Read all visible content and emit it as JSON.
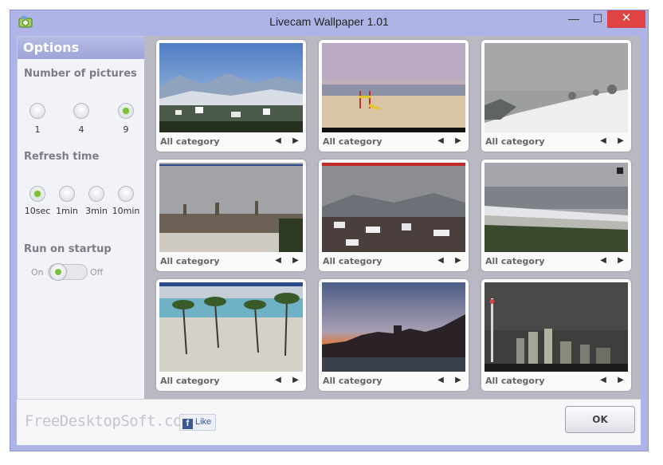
{
  "window": {
    "title": "Livecam Wallpaper 1.01",
    "min_glyph": "—",
    "max_glyph": "☐",
    "close_glyph": "✕",
    "app_icon": "camera-icon"
  },
  "sidebar": {
    "header": "Options",
    "number_of_pictures": {
      "title": "Number of pictures",
      "options": [
        "1",
        "4",
        "9"
      ],
      "selected": "9"
    },
    "refresh_time": {
      "title": "Refresh time",
      "options": [
        "10sec",
        "1min",
        "3min",
        "10min"
      ],
      "selected": "10sec"
    },
    "run_on_startup": {
      "title": "Run on startup",
      "on_label": "On",
      "off_label": "Off",
      "state": "On"
    }
  },
  "cams": [
    {
      "label": "All category",
      "prev": "◀",
      "next": "▶"
    },
    {
      "label": "All category",
      "prev": "◀",
      "next": "▶"
    },
    {
      "label": "All category",
      "prev": "◀",
      "next": "▶"
    },
    {
      "label": "All category",
      "prev": "◀",
      "next": "▶"
    },
    {
      "label": "All category",
      "prev": "◀",
      "next": "▶"
    },
    {
      "label": "All category",
      "prev": "◀",
      "next": "▶"
    },
    {
      "label": "All category",
      "prev": "◀",
      "next": "▶"
    },
    {
      "label": "All category",
      "prev": "◀",
      "next": "▶"
    },
    {
      "label": "All category",
      "prev": "◀",
      "next": "▶"
    }
  ],
  "footer": {
    "brand": "FreeDesktopSoft.com",
    "like_icon": "f",
    "like_label": "Like",
    "ok_label": "OK"
  },
  "colors": {
    "window_frame": "#aeb4e6",
    "sidebar_header": "#9ea4d8",
    "radio_selected": "#7cc13e",
    "close_button": "#e04343"
  }
}
